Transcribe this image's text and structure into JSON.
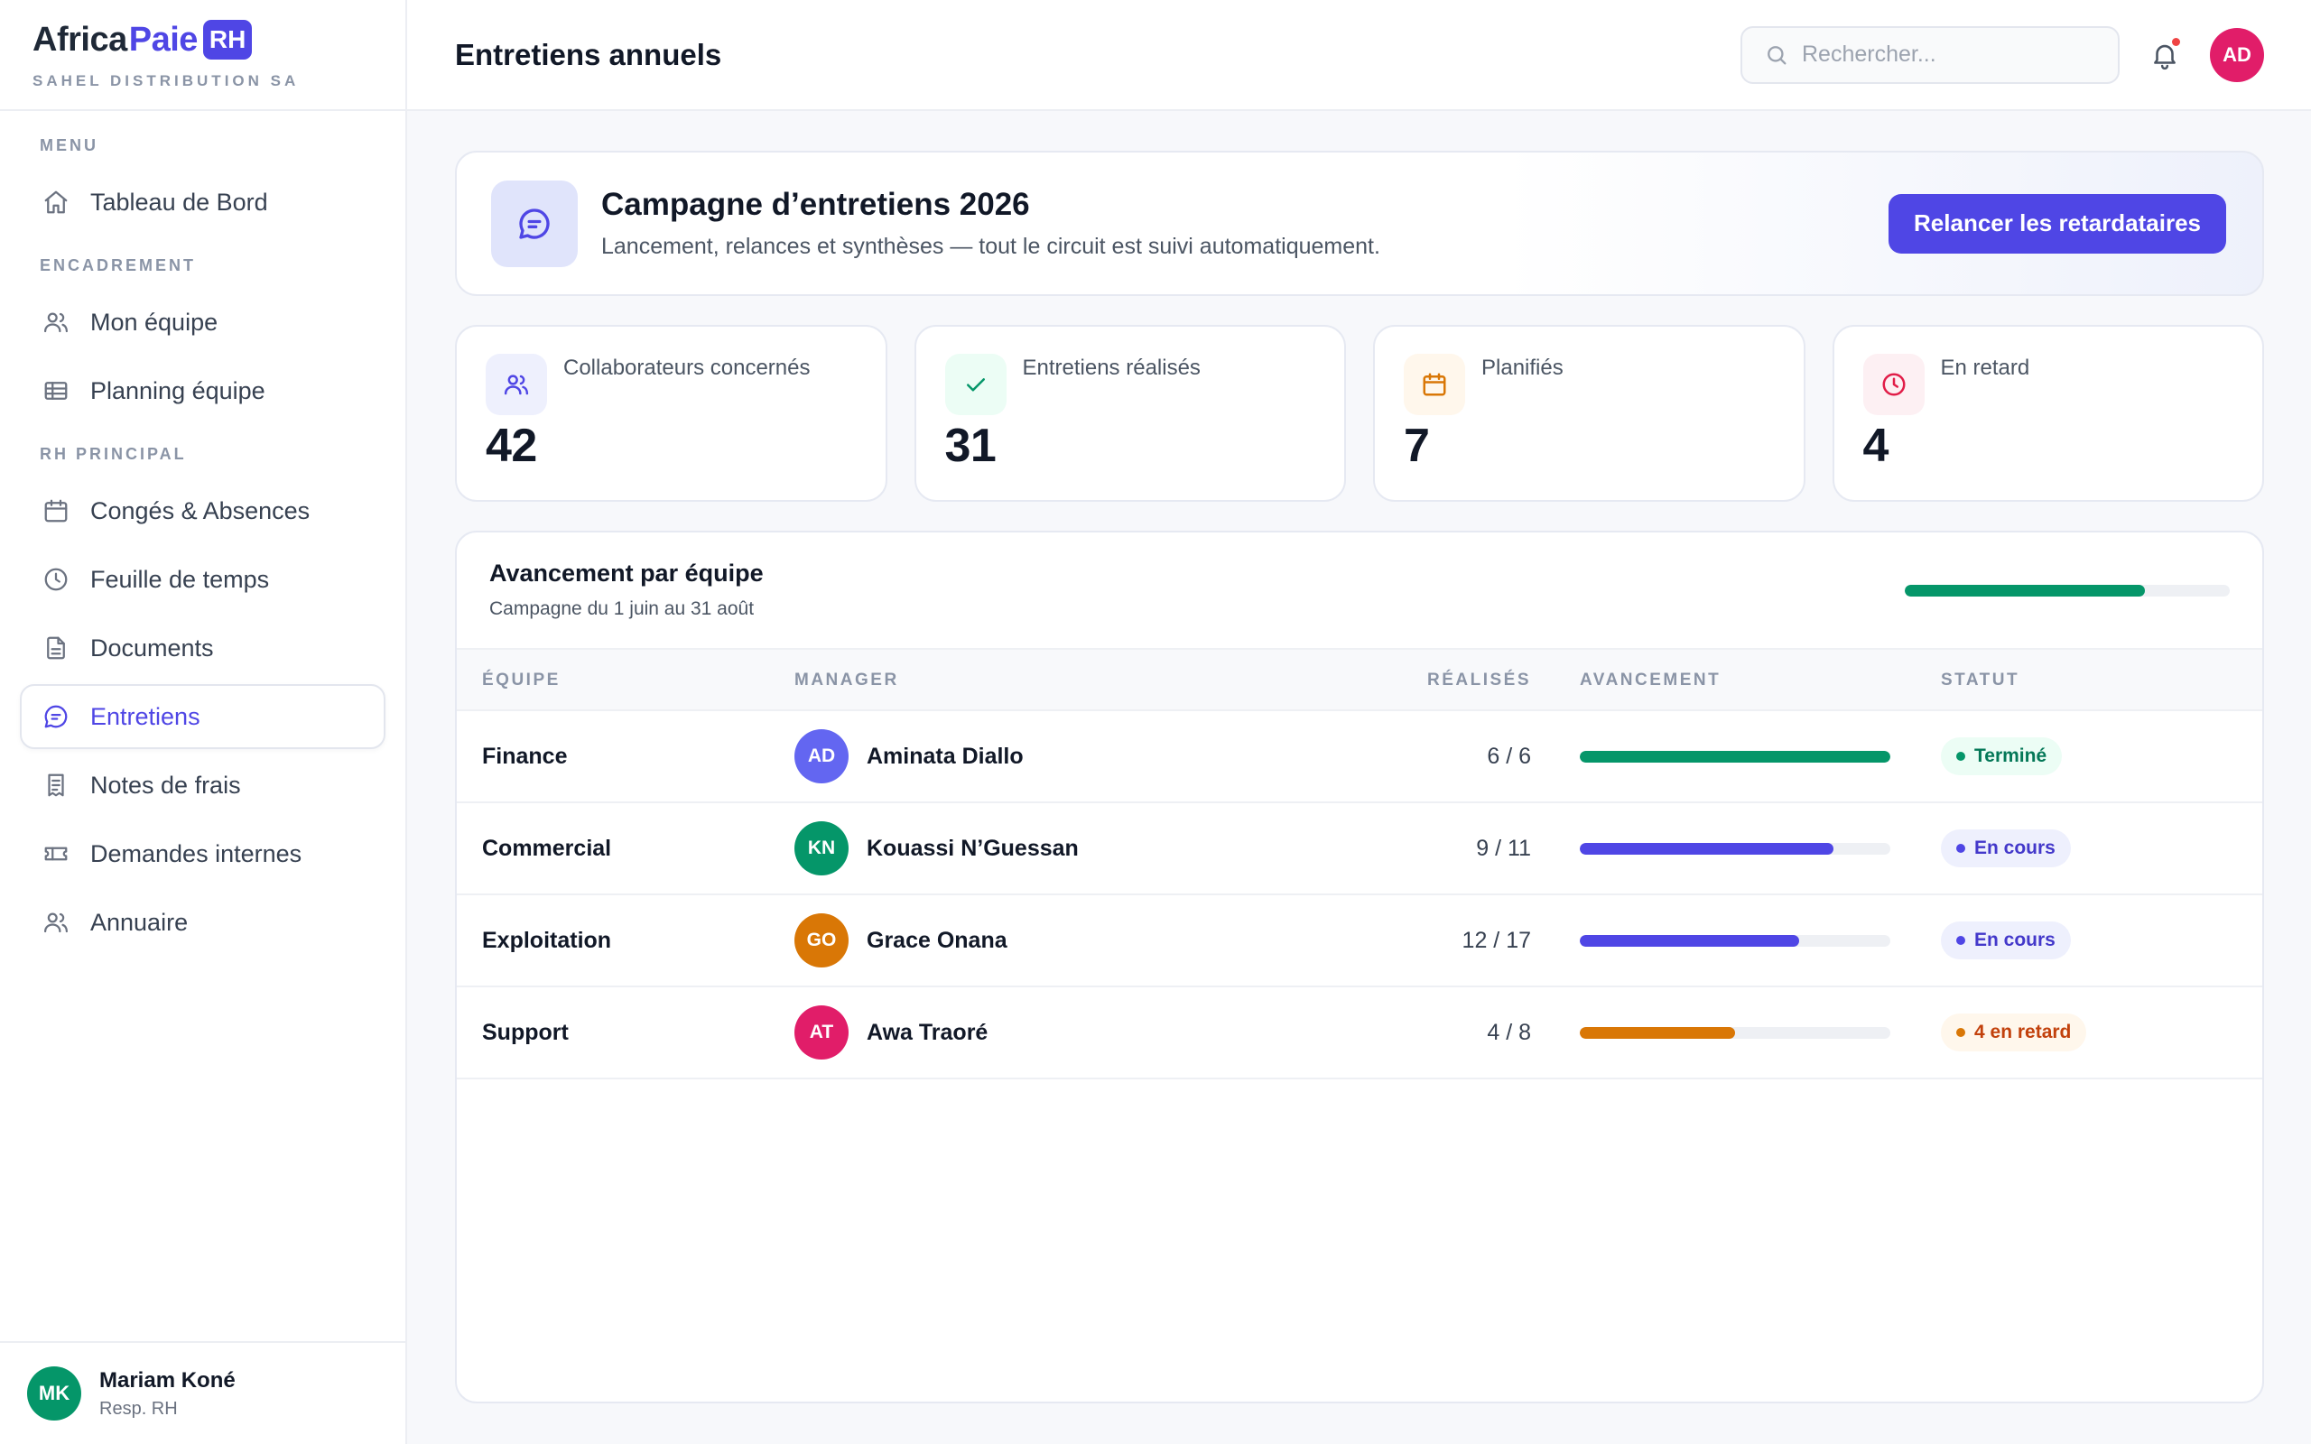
{
  "brand": {
    "africa": "Africa",
    "paie": "Paie",
    "rh": "RH",
    "company": "SAHEL DISTRIBUTION SA"
  },
  "nav": {
    "menu_label": "MENU",
    "encadrement_label": "ENCADREMENT",
    "rh_label": "RH PRINCIPAL",
    "items": [
      {
        "label": "Tableau de Bord",
        "icon": "home-icon"
      },
      {
        "label": "Mon équipe",
        "icon": "users-icon"
      },
      {
        "label": "Planning équipe",
        "icon": "table-icon"
      },
      {
        "label": "Congés & Absences",
        "icon": "calendar-icon"
      },
      {
        "label": "Feuille de temps",
        "icon": "clock-icon"
      },
      {
        "label": "Documents",
        "icon": "document-icon"
      },
      {
        "label": "Entretiens",
        "icon": "chat-icon",
        "active": true
      },
      {
        "label": "Notes de frais",
        "icon": "receipt-icon"
      },
      {
        "label": "Demandes internes",
        "icon": "ticket-icon"
      },
      {
        "label": "Annuaire",
        "icon": "users-icon"
      }
    ]
  },
  "user": {
    "initials": "MK",
    "name": "Mariam Koné",
    "role": "Resp. RH"
  },
  "header": {
    "title": "Entretiens annuels",
    "search_placeholder": "Rechercher...",
    "avatar_initials": "AD"
  },
  "hero": {
    "title": "Campagne d’entretiens 2026",
    "subtitle": "Lancement, relances et synthèses — tout le circuit est suivi automatiquement.",
    "button": "Relancer les retardataires"
  },
  "stats": [
    {
      "label": "Collaborateurs concernés",
      "value": "42",
      "icon": "users-icon",
      "color": "#4f46e5",
      "bg": "#eef0fd"
    },
    {
      "label": "Entretiens réalisés",
      "value": "31",
      "icon": "check-icon",
      "color": "#059669",
      "bg": "#ecfdf5"
    },
    {
      "label": "Planifiés",
      "value": "7",
      "icon": "calendar-icon",
      "color": "#d97706",
      "bg": "#fff7ec"
    },
    {
      "label": "En retard",
      "value": "4",
      "icon": "clock-icon",
      "color": "#e11d48",
      "bg": "#fdf0f3"
    }
  ],
  "progress": {
    "title": "Avancement par équipe",
    "subtitle": "Campagne du 1 juin au 31 août",
    "overall": 0.74,
    "columns": {
      "team": "ÉQUIPE",
      "manager": "MANAGER",
      "done": "RÉALISÉS",
      "progress": "AVANCEMENT",
      "status": "STATUT"
    },
    "rows": [
      {
        "team": "Finance",
        "initials": "AD",
        "avatar_color": "#6366f1",
        "manager": "Aminata Diallo",
        "done": "6 / 6",
        "fraction": 1.0,
        "bar_color": "#059669",
        "status": "Terminé",
        "status_kind": "green"
      },
      {
        "team": "Commercial",
        "initials": "KN",
        "avatar_color": "#059669",
        "manager": "Kouassi N’Guessan",
        "done": "9 / 11",
        "fraction": 0.818,
        "bar_color": "#4f46e5",
        "status": "En cours",
        "status_kind": "blue"
      },
      {
        "team": "Exploitation",
        "initials": "GO",
        "avatar_color": "#d97706",
        "manager": "Grace Onana",
        "done": "12 / 17",
        "fraction": 0.706,
        "bar_color": "#4f46e5",
        "status": "En cours",
        "status_kind": "blue"
      },
      {
        "team": "Support",
        "initials": "AT",
        "avatar_color": "#e11d69",
        "manager": "Awa Traoré",
        "done": "4 / 8",
        "fraction": 0.5,
        "bar_color": "#d97706",
        "status": "4 en retard",
        "status_kind": "orange"
      }
    ]
  }
}
